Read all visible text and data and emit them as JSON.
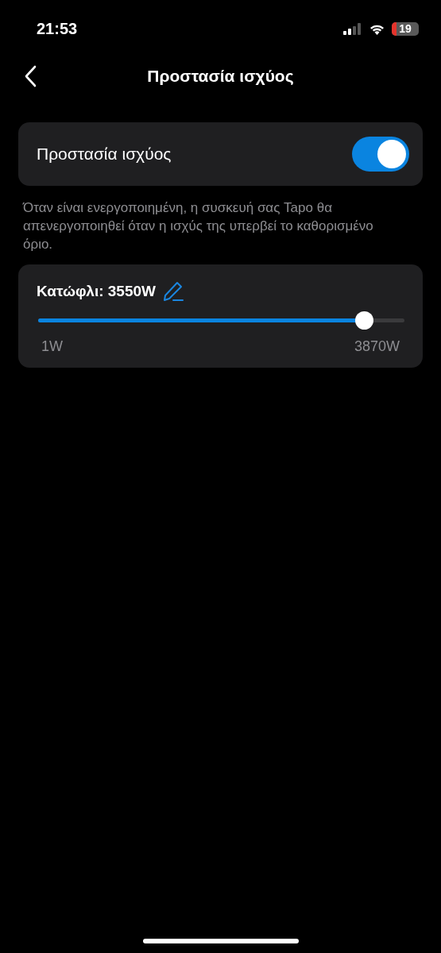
{
  "status_bar": {
    "time": "21:53",
    "battery": "19"
  },
  "header": {
    "title": "Προστασία ισχύος"
  },
  "protection": {
    "label": "Προστασία ισχύος",
    "on": true
  },
  "description": "Όταν είναι ενεργοποιημένη, η συσκευή σας Tapo θα απενεργοποιηθεί όταν η ισχύς της υπερβεί το καθορισμένο όριο.",
  "threshold": {
    "label": "Κατώφλι: 3550W",
    "level": 0.89,
    "min_label": "1W",
    "max_label": "3870W"
  }
}
